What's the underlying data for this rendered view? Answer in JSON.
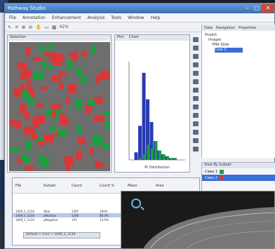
{
  "window": {
    "title": "Pathway Studio",
    "menu": [
      "File",
      "Annotation",
      "Enhancement",
      "Analysis",
      "Tools",
      "Window",
      "Help"
    ],
    "toolbar": {
      "zoom": "42%"
    }
  },
  "left_panel": {
    "title": "Selection"
  },
  "chart_panel": {
    "tabs": [
      "Plot",
      "Chart"
    ],
    "xlabel": "Pt Distribution",
    "chart_data": {
      "type": "bar",
      "categories": [
        "1",
        "2",
        "3",
        "4",
        "5",
        "6",
        "7",
        "8",
        "9",
        "10",
        "11",
        "12"
      ],
      "series": [
        {
          "name": "",
          "color": "#2a3ab4",
          "values": [
            0,
            4,
            18,
            46,
            32,
            20,
            10,
            5,
            3,
            2,
            1,
            1
          ]
        },
        {
          "name": "",
          "color": "#1aa040",
          "values": [
            0,
            0,
            1,
            3,
            8,
            6,
            10,
            5,
            3,
            2,
            1,
            1
          ]
        }
      ]
    }
  },
  "right_panel": {
    "tabs": [
      "Data",
      "Navigation",
      "Properties"
    ],
    "tree": [
      "Project",
      "Images",
      "TMA Slide",
      "Core 3"
    ]
  },
  "classes_panel": {
    "title": "View By Subset",
    "rows": [
      {
        "name": "Class 1",
        "color": "#1aa040"
      },
      {
        "name": "Class 2",
        "color": "#d83838"
      }
    ]
  },
  "table": {
    "headers": [
      "File",
      "Subset",
      "Count",
      "Count %",
      "Mean",
      "Area"
    ],
    "rows": [
      [
        "1009_1_1234",
        "Total",
        "1397",
        "100%",
        "",
        ""
      ],
      [
        "1009_1_1234",
        "pPositive",
        "1206",
        "86.4%",
        "",
        ""
      ],
      [
        "1009_1_1234",
        "pNegative",
        "191",
        "13.6%",
        "",
        ""
      ]
    ]
  },
  "status": {
    "text": "Default > Core > 1009_1_1234"
  },
  "colors": {
    "positive": "#1aa040",
    "negative": "#d83838",
    "accent": "#3a6ed4"
  }
}
